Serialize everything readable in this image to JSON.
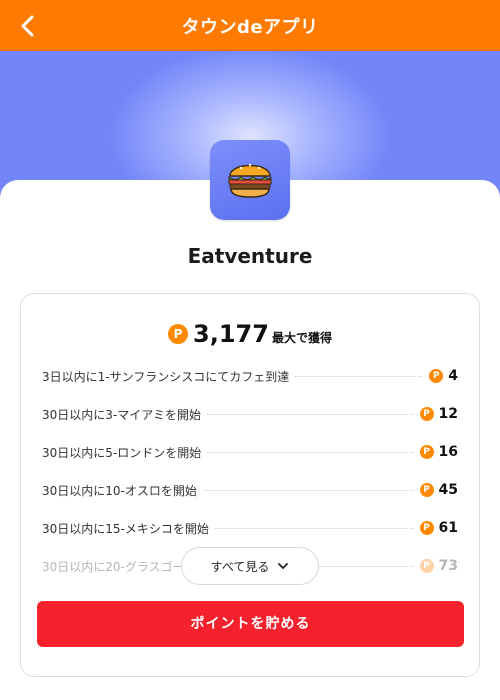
{
  "header": {
    "title": "タウンdeアプリ",
    "back_icon": "chevron-left-icon",
    "bg_color": "#ff7a00"
  },
  "app": {
    "name": "Eatventure",
    "icon": "hamburger-icon"
  },
  "rewards": {
    "total": "3,177",
    "total_suffix": "最大で獲得",
    "coin_symbol": "P",
    "items": [
      {
        "label": "3日以内に1-サンフランシスコにてカフェ到達",
        "points": "4"
      },
      {
        "label": "30日以内に3-マイアミを開始",
        "points": "12"
      },
      {
        "label": "30日以内に5-ロンドンを開始",
        "points": "16"
      },
      {
        "label": "30日以内に10-オスロを開始",
        "points": "45"
      },
      {
        "label": "30日以内に15-メキシコを開始",
        "points": "61"
      },
      {
        "label": "30日以内に20-グラスゴー",
        "points": "73"
      }
    ],
    "see_all_label": "すべて見る"
  },
  "cta": {
    "label": "ポイントを貯める",
    "color": "#f5222d"
  }
}
